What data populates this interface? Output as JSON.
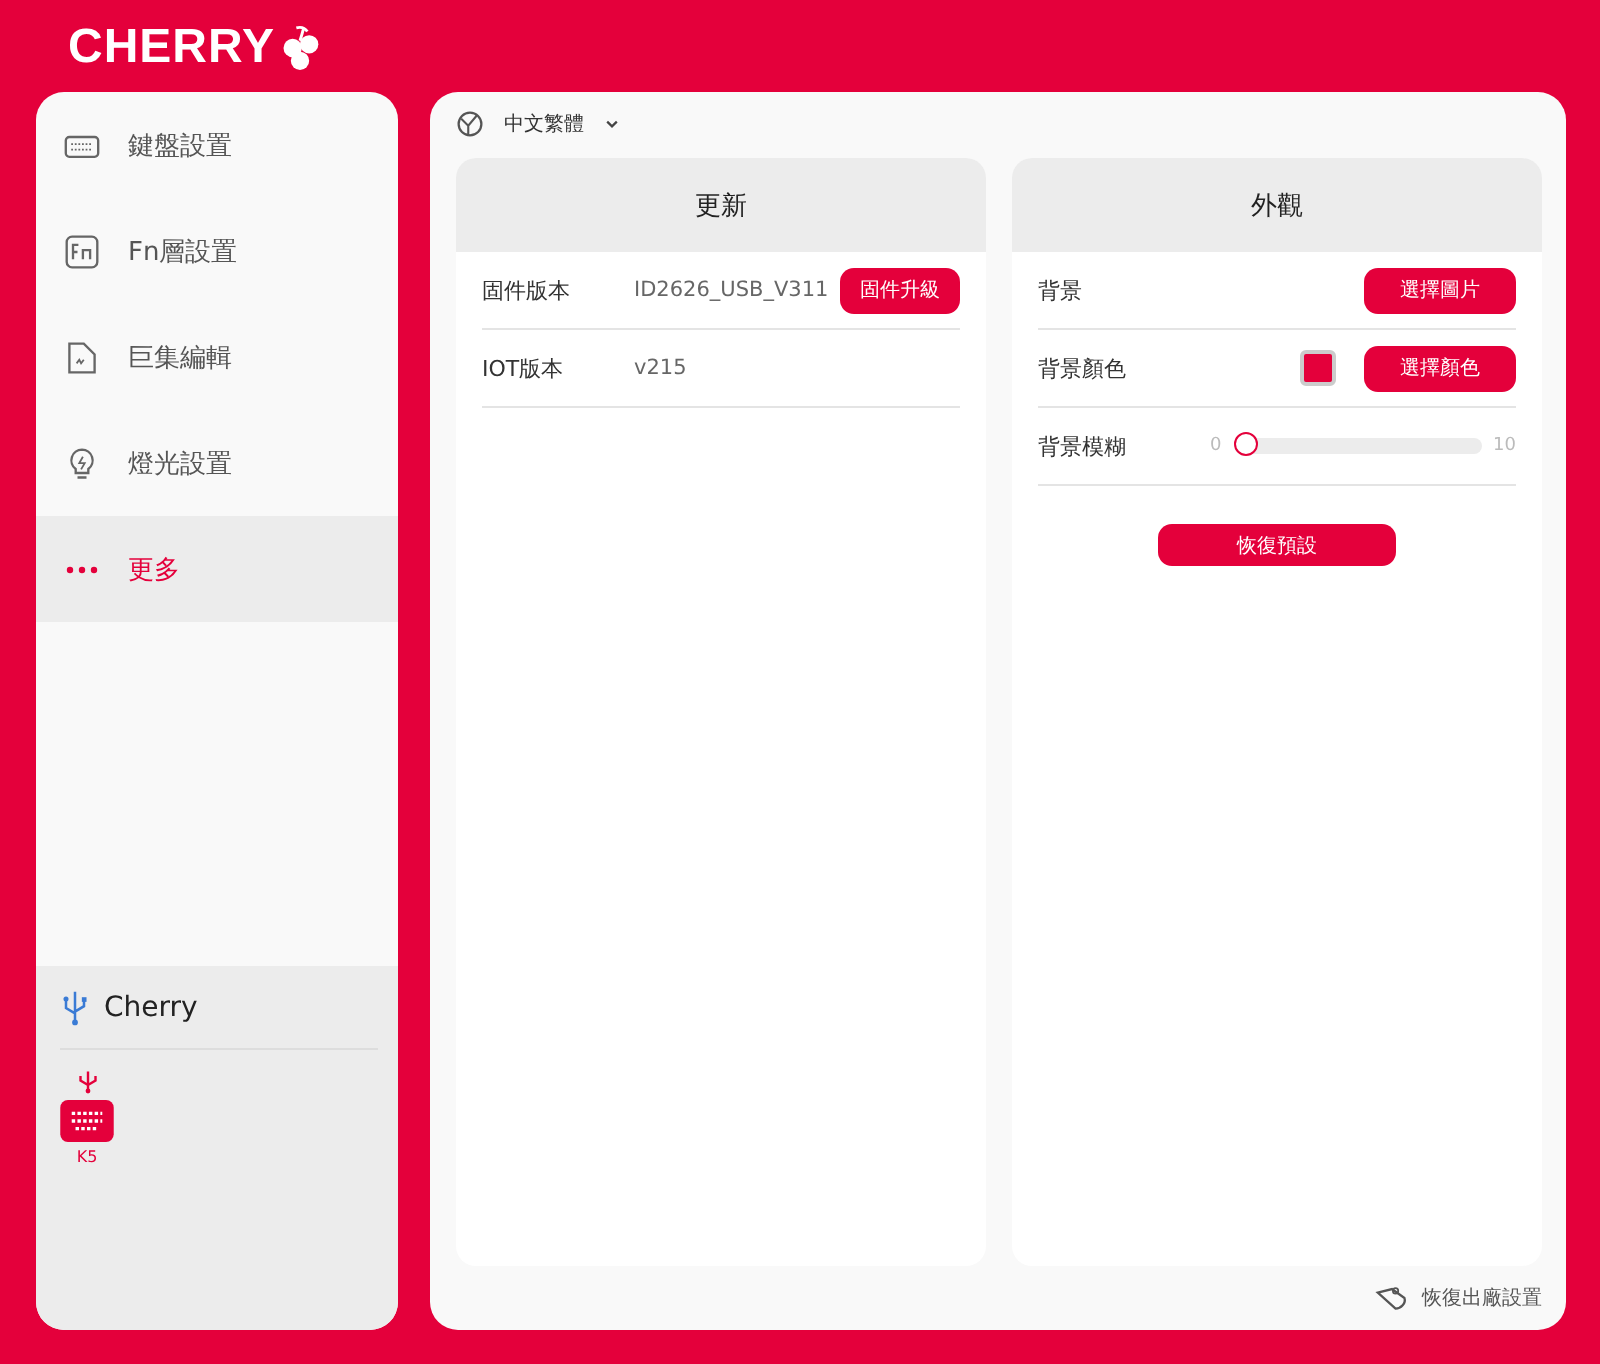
{
  "logo": {
    "text": "CHERRY"
  },
  "sidebar": {
    "items": [
      {
        "kind": "keyboard",
        "label": "鍵盤設置",
        "selected": false
      },
      {
        "kind": "fn",
        "label": "Fn層設置",
        "selected": false
      },
      {
        "kind": "macro",
        "label": "巨集編輯",
        "selected": false
      },
      {
        "kind": "light",
        "label": "燈光設置",
        "selected": false
      },
      {
        "kind": "more",
        "label": "更多",
        "selected": true
      }
    ],
    "device_group": {
      "name": "Cherry",
      "devices": [
        {
          "label": "K5"
        }
      ]
    }
  },
  "language": {
    "value": "中文繁體"
  },
  "update_panel": {
    "title": "更新",
    "rows": [
      {
        "label": "固件版本",
        "value": "ID2626_USB_V311",
        "button": "固件升級"
      },
      {
        "label": "IOT版本",
        "value": "v215"
      }
    ]
  },
  "appearance_panel": {
    "title": "外觀",
    "rows": [
      {
        "kind": "button",
        "label": "背景",
        "button": "選擇圖片"
      },
      {
        "kind": "color",
        "label": "背景顏色",
        "color": "#e4003b",
        "button": "選擇顏色"
      },
      {
        "kind": "slider",
        "label": "背景模糊",
        "min": "0",
        "max": "10",
        "level": 0
      }
    ],
    "reset_button": "恢復預設"
  },
  "factory_reset": "恢復出廠設置"
}
